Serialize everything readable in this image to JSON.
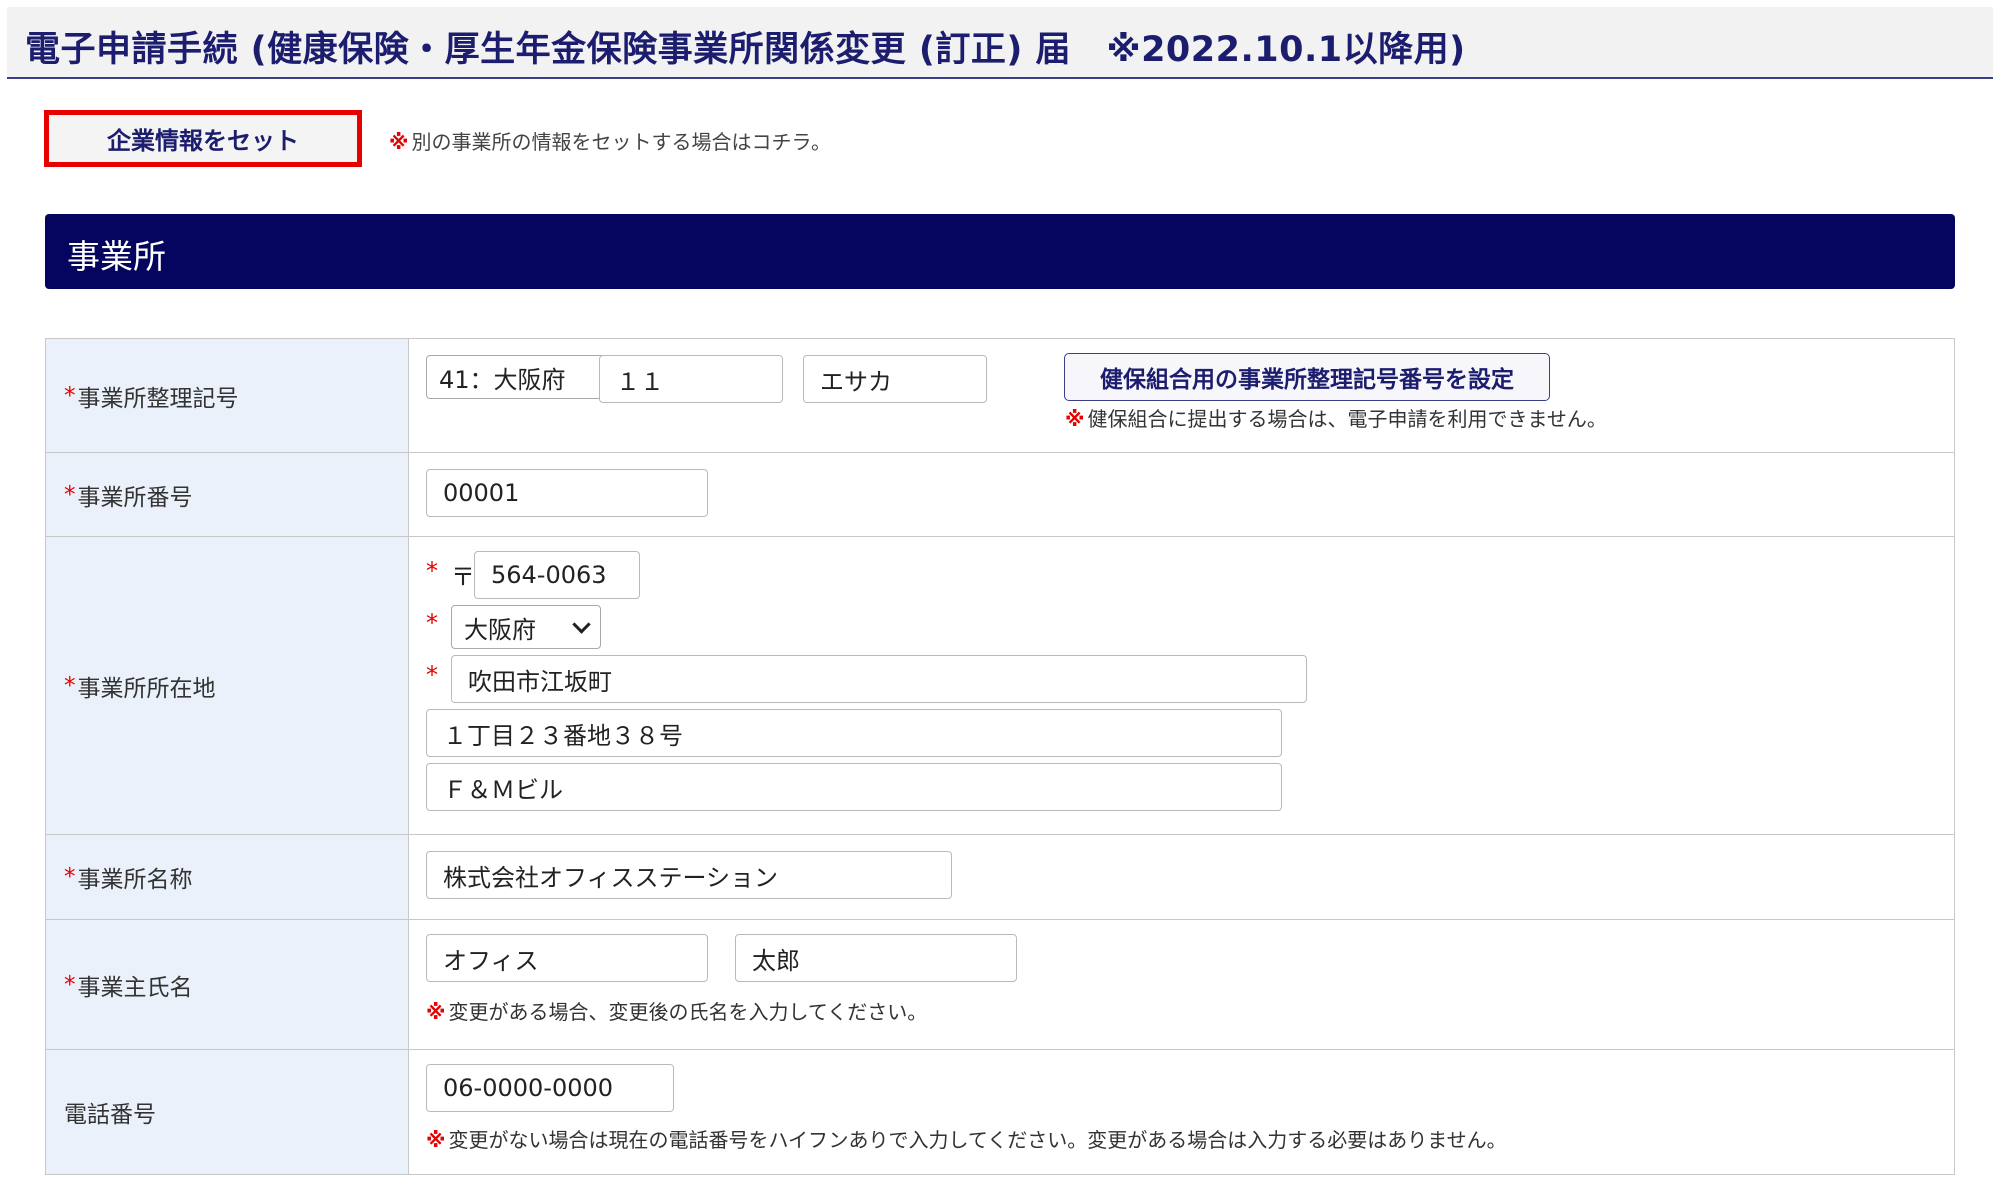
{
  "header": {
    "title": "電子申請手続 (健康保険・厚生年金保険事業所関係変更 (訂正) 届　※2022.10.1以降用)"
  },
  "actions": {
    "set_company_label": "企業情報をセット",
    "set_company_note_mark": "※",
    "set_company_note": "別の事業所の情報をセットする場合はコチラ。"
  },
  "section": {
    "title": "事業所"
  },
  "colors": {
    "header_text": "#1c1d6e",
    "section_bar": "#05055f",
    "label_bg": "#eaf1fa",
    "required": "#e60000",
    "highlight_border": "#e60000"
  },
  "form": {
    "required_mark": "*",
    "note_mark": "※",
    "office_code": {
      "label": "事業所整理記号",
      "prefecture_select": "41：大阪府",
      "code1": "１１",
      "code2": "エサカ",
      "kenpo_button": "健保組合用の事業所整理記号番号を設定",
      "note": "健保組合に提出する場合は、電子申請を利用できません。"
    },
    "office_number": {
      "label": "事業所番号",
      "value": "00001"
    },
    "address": {
      "label": "事業所所在地",
      "postal_mark": "〒",
      "postal_code": "564-0063",
      "prefecture": "大阪府",
      "city": "吹田市江坂町",
      "line1": "１丁目２３番地３８号",
      "line2": "Ｆ＆Ｍビル"
    },
    "office_name": {
      "label": "事業所名称",
      "value": "株式会社オフィスステーション"
    },
    "owner_name": {
      "label": "事業主氏名",
      "last_name": "オフィス",
      "first_name": "太郎",
      "note": "変更がある場合、変更後の氏名を入力してください。"
    },
    "phone": {
      "label": "電話番号",
      "value": "06-0000-0000",
      "note": "変更がない場合は現在の電話番号をハイフンありで入力してください。変更がある場合は入力する必要はありません。"
    }
  }
}
